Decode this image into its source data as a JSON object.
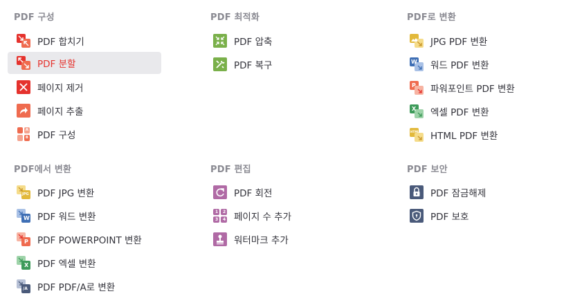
{
  "colors": {
    "red": "#e5322d",
    "orange": "#ef6b4f",
    "green": "#7ab04a",
    "yellow": "#e2b93b",
    "blue": "#3f6fb5",
    "navy": "#4a5a7a",
    "purple": "#b06aa5",
    "excel": "#3e9b5a"
  },
  "columns": [
    {
      "heading": "PDF 구성",
      "items": [
        {
          "label": "PDF 합치기",
          "icon": "merge-icon"
        },
        {
          "label": "PDF 분할",
          "icon": "split-icon",
          "active": true
        },
        {
          "label": "페이지 제거",
          "icon": "remove-pages-icon"
        },
        {
          "label": "페이지 추출",
          "icon": "extract-pages-icon"
        },
        {
          "label": "PDF 구성",
          "icon": "organize-icon"
        }
      ]
    },
    {
      "heading": "PDF 최적화",
      "items": [
        {
          "label": "PDF 압축",
          "icon": "compress-icon"
        },
        {
          "label": "PDF 복구",
          "icon": "repair-icon"
        }
      ]
    },
    {
      "heading": "PDF로 변환",
      "items": [
        {
          "label": "JPG PDF 변환",
          "icon": "jpg-to-pdf-icon"
        },
        {
          "label": "워드 PDF 변환",
          "icon": "word-to-pdf-icon"
        },
        {
          "label": "파워포인트 PDF 변환",
          "icon": "powerpoint-to-pdf-icon"
        },
        {
          "label": "엑셀 PDF 변환",
          "icon": "excel-to-pdf-icon"
        },
        {
          "label": "HTML PDF 변환",
          "icon": "html-to-pdf-icon"
        }
      ]
    },
    {
      "heading": "PDF에서 변환",
      "items": [
        {
          "label": "PDF JPG 변환",
          "icon": "pdf-to-jpg-icon"
        },
        {
          "label": "PDF 워드 변환",
          "icon": "pdf-to-word-icon"
        },
        {
          "label": "PDF POWERPOINT 변환",
          "icon": "pdf-to-powerpoint-icon"
        },
        {
          "label": "PDF 엑셀 변환",
          "icon": "pdf-to-excel-icon"
        },
        {
          "label": "PDF PDF/A로 변환",
          "icon": "pdf-to-pdfa-icon"
        }
      ]
    },
    {
      "heading": "PDF 편집",
      "items": [
        {
          "label": "PDF 회전",
          "icon": "rotate-icon"
        },
        {
          "label": "페이지 수 추가",
          "icon": "page-numbers-icon"
        },
        {
          "label": "워터마크 추가",
          "icon": "watermark-icon"
        }
      ]
    },
    {
      "heading": "PDF 보안",
      "items": [
        {
          "label": "PDF 잠금해제",
          "icon": "unlock-icon"
        },
        {
          "label": "PDF 보호",
          "icon": "protect-icon"
        }
      ]
    }
  ],
  "icon_text": {
    "word": "W",
    "powerpoint": "P",
    "excel": "X",
    "html": "HTML",
    "jpg": "JPG",
    "pdfa": "/A",
    "organize_a": "A",
    "organize_b": "B",
    "pn1": "1",
    "pn2": "2",
    "pn3": "3",
    "pn4": "4"
  }
}
